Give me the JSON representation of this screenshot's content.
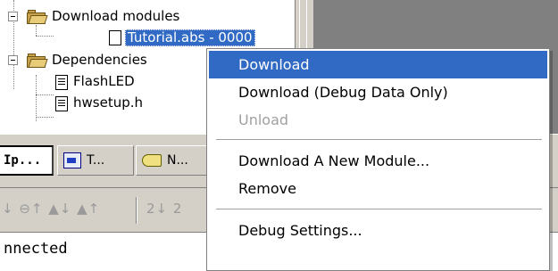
{
  "tree": {
    "download_modules": "Download modules",
    "tutorial_file": "Tutorial.abs - 0000",
    "dependencies": "Dependencies",
    "flashled": "FlashLED",
    "hwsetup": "hwsetup.h"
  },
  "tabs": {
    "tab1": "Ip...",
    "tab2": "T...",
    "tab3": "N..."
  },
  "toolbar": {
    "group1": "↓ ⊖↑ ▲↓ ▲↑",
    "group2": "2↓ 2"
  },
  "output": {
    "text": "nnected"
  },
  "context_menu": {
    "items": [
      {
        "label": "Download",
        "state": "highlighted"
      },
      {
        "label": "Download (Debug Data Only)",
        "state": "normal"
      },
      {
        "label": "Unload",
        "state": "disabled"
      },
      {
        "label": "Download A New Module...",
        "state": "normal"
      },
      {
        "label": "Remove",
        "state": "normal"
      },
      {
        "label": "Debug Settings...",
        "state": "normal"
      }
    ]
  },
  "colors": {
    "selection": "#316ac5",
    "face": "#d4d0c8",
    "shadow": "#808080"
  }
}
